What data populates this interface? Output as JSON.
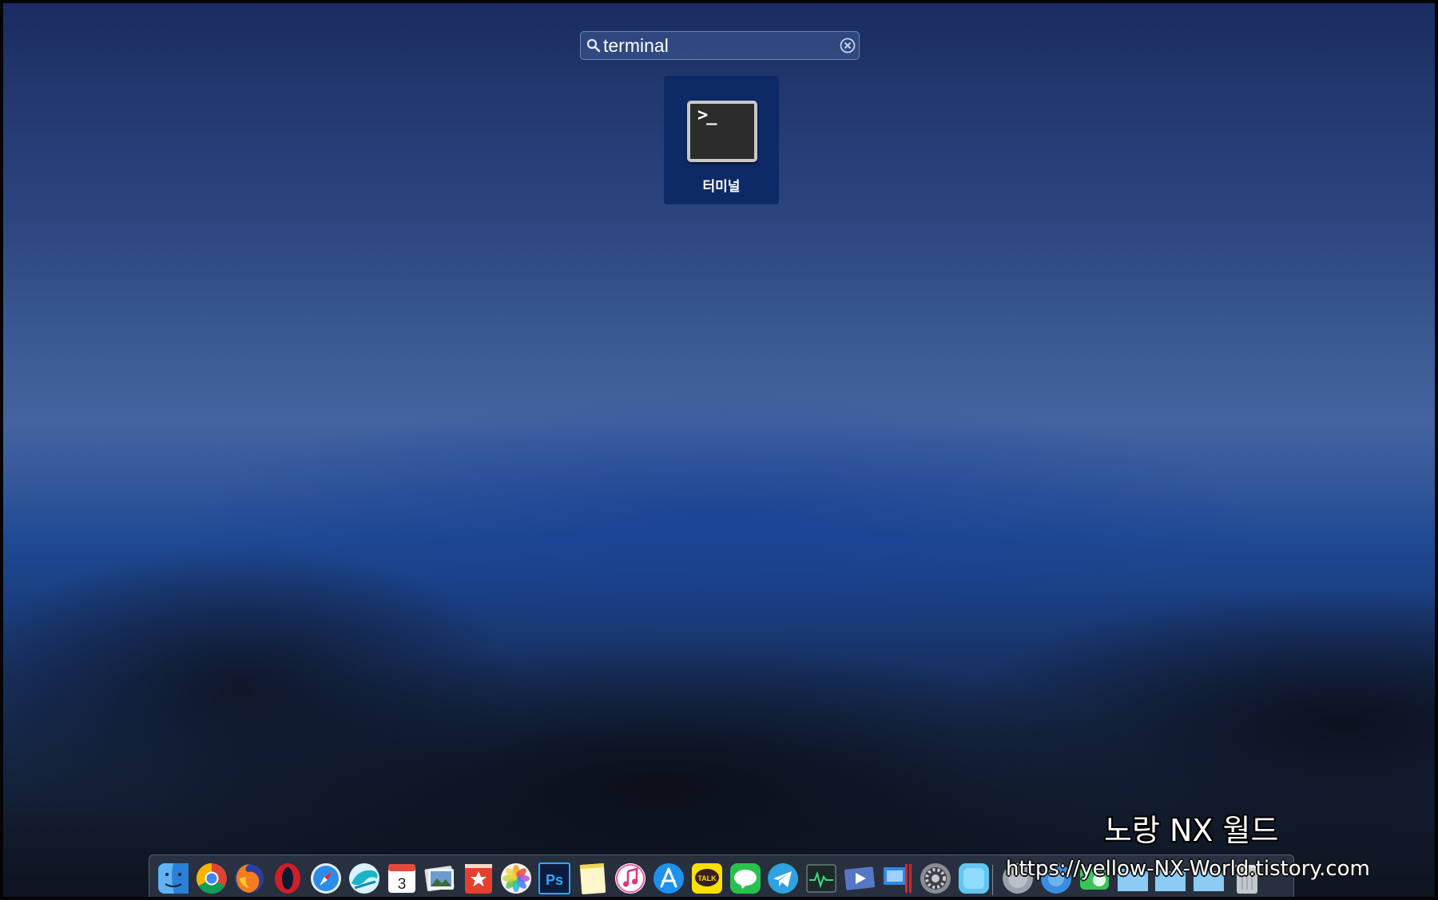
{
  "launchpad": {
    "search": {
      "value": "terminal",
      "icon": "magnifying-glass",
      "clear_icon": "circled-x"
    },
    "result": {
      "label": "터미널",
      "icon": "terminal-app",
      "icon_glyph": ">_"
    }
  },
  "dock": {
    "items": [
      {
        "name": "finder",
        "icon": "finder-face",
        "running": true
      },
      {
        "name": "chrome",
        "icon": "chrome-logo",
        "running": true
      },
      {
        "name": "firefox",
        "icon": "firefox-logo",
        "running": true
      },
      {
        "name": "opera",
        "icon": "opera-logo",
        "running": true
      },
      {
        "name": "safari",
        "icon": "safari-compass",
        "running": false
      },
      {
        "name": "whale",
        "icon": "whale-logo",
        "running": false
      },
      {
        "name": "calendar",
        "icon": "calendar",
        "running": true,
        "glyph": "3"
      },
      {
        "name": "image-capture",
        "icon": "photo-stack",
        "running": false
      },
      {
        "name": "bookmark-app",
        "icon": "red-star-bookmark",
        "running": false
      },
      {
        "name": "photos",
        "icon": "photos-flower",
        "running": true
      },
      {
        "name": "photoshop",
        "icon": "photoshop",
        "running": true,
        "glyph": "Ps"
      },
      {
        "name": "notes",
        "icon": "notes-pad",
        "running": false
      },
      {
        "name": "itunes",
        "icon": "music-note",
        "running": false
      },
      {
        "name": "app-store",
        "icon": "app-store-a",
        "running": true
      },
      {
        "name": "kakaotalk",
        "icon": "kakaotalk-bubble",
        "running": true,
        "glyph": "TALK"
      },
      {
        "name": "line",
        "icon": "line-bubble",
        "running": false
      },
      {
        "name": "telegram",
        "icon": "telegram-plane",
        "running": false
      },
      {
        "name": "activity-monitor",
        "icon": "activity-graph",
        "running": false
      },
      {
        "name": "keynote-remote",
        "icon": "play-arrow-card",
        "running": false
      },
      {
        "name": "parallels",
        "icon": "parallels-windows",
        "running": false
      },
      {
        "name": "system-preferences",
        "icon": "gear",
        "running": false
      },
      {
        "name": "blue-app",
        "icon": "blue-square-app",
        "running": false
      },
      {
        "name": "downloads-stack",
        "icon": "gray-circle",
        "running": true
      },
      {
        "name": "blue-circle-stack",
        "icon": "blue-circle",
        "running": false
      },
      {
        "name": "green-stack",
        "icon": "green-app",
        "running": false
      },
      {
        "name": "folder-1",
        "icon": "folder",
        "running": false
      },
      {
        "name": "folder-2",
        "icon": "folder",
        "running": false
      },
      {
        "name": "folder-3",
        "icon": "folder",
        "running": false
      },
      {
        "name": "trash",
        "icon": "trash-can",
        "running": false
      }
    ]
  },
  "watermark": {
    "title": "노랑 NX 월드",
    "url": "https://yellow-NX-World.tistory.com"
  }
}
